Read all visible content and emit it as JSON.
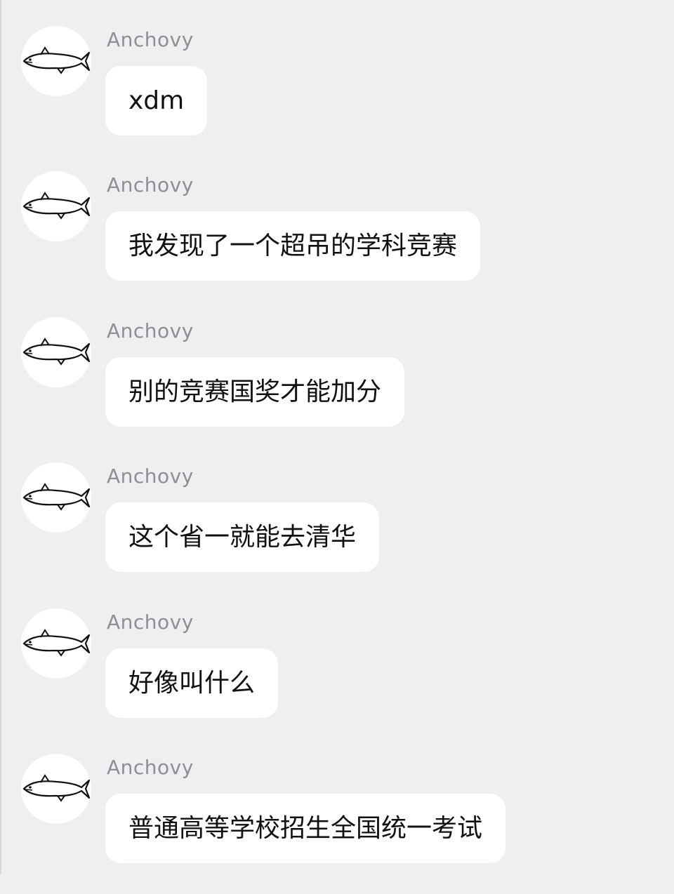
{
  "colors": {
    "background": "#efeff1",
    "bubble": "#ffffff",
    "sender_name": "#8e8e93",
    "message_text": "#111111"
  },
  "avatar_icon": "fish-icon",
  "messages": [
    {
      "sender": "Anchovy",
      "text": "xdm"
    },
    {
      "sender": "Anchovy",
      "text": "我发现了一个超吊的学科竞赛"
    },
    {
      "sender": "Anchovy",
      "text": "别的竞赛国奖才能加分"
    },
    {
      "sender": "Anchovy",
      "text": "这个省一就能去清华"
    },
    {
      "sender": "Anchovy",
      "text": "好像叫什么"
    },
    {
      "sender": "Anchovy",
      "text": "普通高等学校招生全国统一考试"
    }
  ]
}
